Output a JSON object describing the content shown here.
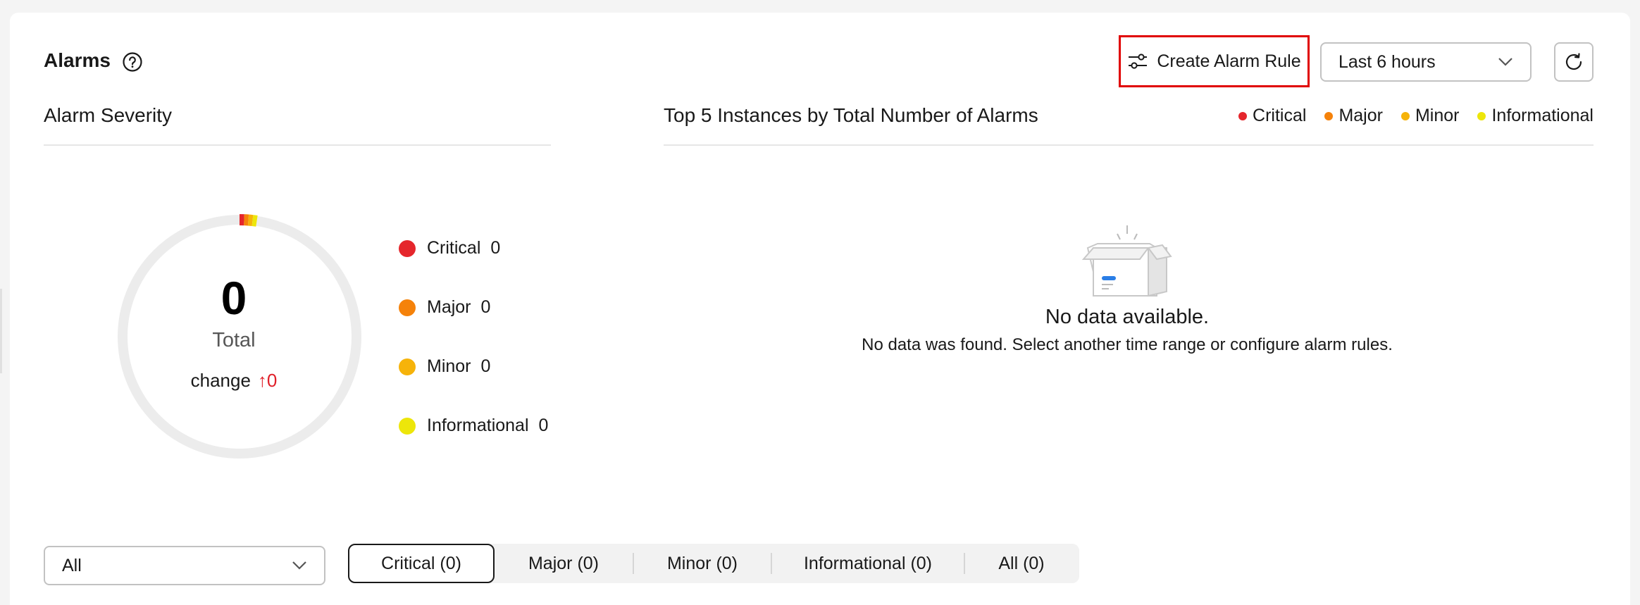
{
  "header": {
    "title": "Alarms",
    "create_label": "Create Alarm Rule",
    "time_range": "Last 6 hours"
  },
  "severity": {
    "heading": "Alarm Severity",
    "total": "0",
    "total_label": "Total",
    "change_label": "change",
    "change_arrow": "↑",
    "change_value": "0",
    "items": [
      {
        "label": "Critical",
        "count": "0",
        "color": "#e5262c"
      },
      {
        "label": "Major",
        "count": "0",
        "color": "#f5820a"
      },
      {
        "label": "Minor",
        "count": "0",
        "color": "#f6b30a"
      },
      {
        "label": "Informational",
        "count": "0",
        "color": "#ede60a"
      }
    ]
  },
  "top5": {
    "heading": "Top 5 Instances by Total Number of Alarms",
    "legend": [
      {
        "label": "Critical",
        "color": "#e5262c"
      },
      {
        "label": "Major",
        "color": "#f5820a"
      },
      {
        "label": "Minor",
        "color": "#f6b30a"
      },
      {
        "label": "Informational",
        "color": "#ede60a"
      }
    ],
    "empty_title": "No data available.",
    "empty_desc": "No data was found. Select another time range or configure alarm rules."
  },
  "filter": {
    "selected": "All"
  },
  "tabs": [
    {
      "label": "Critical (0)",
      "active": true
    },
    {
      "label": "Major (0)",
      "active": false
    },
    {
      "label": "Minor (0)",
      "active": false
    },
    {
      "label": "Informational (0)",
      "active": false
    },
    {
      "label": "All (0)",
      "active": false
    }
  ]
}
